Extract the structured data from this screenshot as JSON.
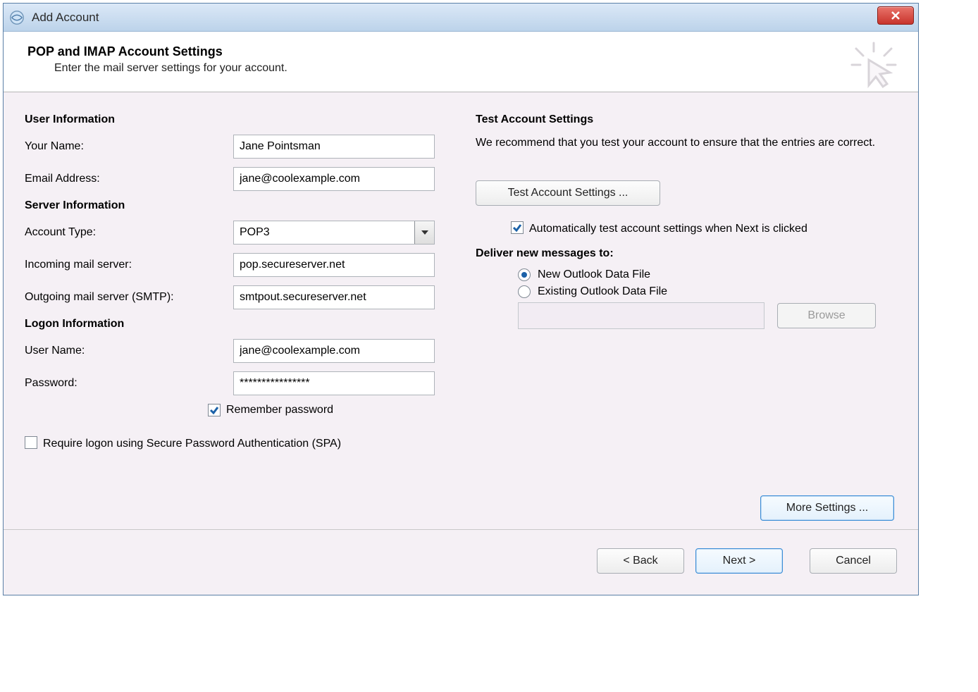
{
  "window": {
    "title": "Add Account"
  },
  "header": {
    "title": "POP and IMAP Account Settings",
    "subtitle": "Enter the mail server settings for your account."
  },
  "sections": {
    "user_info": "User Information",
    "server_info": "Server Information",
    "logon_info": "Logon Information",
    "test_settings": "Test Account Settings"
  },
  "labels": {
    "your_name": "Your Name:",
    "email": "Email Address:",
    "account_type": "Account Type:",
    "incoming": "Incoming mail server:",
    "outgoing": "Outgoing mail server (SMTP):",
    "username": "User Name:",
    "password": "Password:",
    "remember": "Remember password",
    "spa": "Require logon using Secure Password Authentication (SPA)",
    "test_desc": "We recommend that you test your account to ensure that the entries are correct.",
    "test_btn": "Test Account Settings ...",
    "auto_test": "Automatically test account settings when Next is clicked",
    "deliver_title": "Deliver new messages to:",
    "radio_new": "New Outlook Data File",
    "radio_existing": "Existing Outlook Data File",
    "browse": "Browse",
    "more_settings": "More Settings ..."
  },
  "values": {
    "your_name": "Jane Pointsman",
    "email": "jane@coolexample.com",
    "account_type": "POP3",
    "incoming": "pop.secureserver.net",
    "outgoing": "smtpout.secureserver.net",
    "username": "jane@coolexample.com",
    "password": "****************"
  },
  "state": {
    "remember_checked": true,
    "spa_checked": false,
    "auto_test_checked": true,
    "deliver_selection": "new"
  },
  "footer": {
    "back": "< Back",
    "next": "Next >",
    "cancel": "Cancel"
  }
}
